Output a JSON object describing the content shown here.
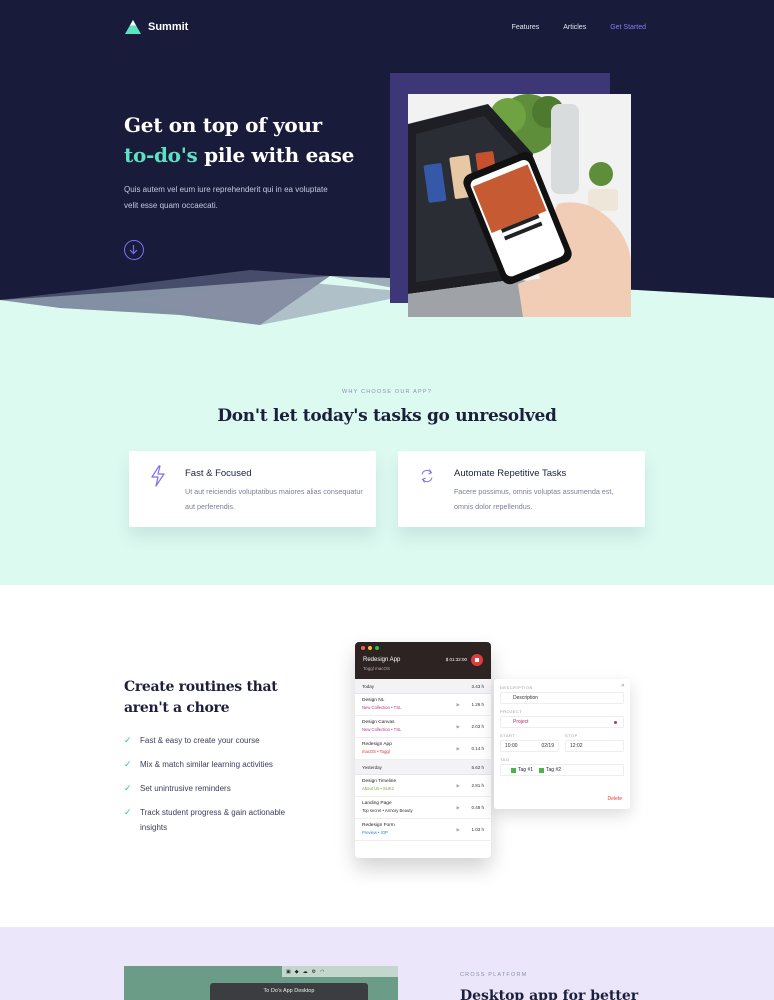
{
  "nav": {
    "brand": "Summit",
    "links": [
      "Features",
      "Articles"
    ],
    "cta": "Get Started"
  },
  "hero": {
    "title_line1": "Get on top of your",
    "title_accent": "to-do's",
    "title_rest": " pile with ease",
    "text": "Quis autem vel eum iure reprehenderit qui in ea voluptate velit esse quam occaecati."
  },
  "features": {
    "eyebrow": "WHY CHOOSE OUR APP?",
    "title": "Don't let today's tasks go unresolved",
    "cards": [
      {
        "title": "Fast & Focused",
        "desc": "Ut aut reiciendis voluptatibus maiores alias consequatur aut perferendis.",
        "icon": "lightning-icon"
      },
      {
        "title": "Automate Repetitive Tasks",
        "desc": "Facere possimus, omnis voluptas assumenda est, omnis dolor repellendus.",
        "icon": "sync-icon"
      }
    ]
  },
  "routines": {
    "title": "Create routines that aren't a chore",
    "items": [
      "Fast & easy to create your course",
      "Mix & match similar learning activities",
      "Set unintrusive reminders",
      "Track student progress & gain actionable insights"
    ]
  },
  "app": {
    "project": "Redesign App",
    "subtitle": "Toggl macOS",
    "timer": "$ 01:32:00",
    "groups": [
      {
        "label": "Today",
        "total": "3.43 h",
        "rows": [
          {
            "name": "Design NL",
            "client": "New Collection • TSL",
            "color": "#b03a8e",
            "dur": "1.26 h"
          },
          {
            "name": "Design Canvas",
            "client": "New Collection • TSL",
            "color": "#b03a8e",
            "dur": "2.03 h"
          },
          {
            "name": "Redesign App",
            "client": "macOS • Toggl",
            "color": "#d8303a",
            "dur": "0.14 h"
          }
        ]
      },
      {
        "label": "Yesterday",
        "total": "5.62 h",
        "rows": [
          {
            "name": "Design Timeline",
            "client": "About Us • SUK2",
            "color": "#6aa83a",
            "dur": "2.81 h"
          },
          {
            "name": "Landing Page",
            "client": "Top secret • Armory Beauty",
            "color": "#333333",
            "dur": "0.48 h"
          },
          {
            "name": "Redesign Form",
            "client": "Preview • IOP",
            "color": "#2e7dd6",
            "dur": "1.03 h"
          }
        ]
      }
    ]
  },
  "detail": {
    "desc_label": "DESCRIPTION",
    "desc_value": "Description",
    "project_label": "PROJECT",
    "project_value": "Project",
    "start_label": "START",
    "start_time": "10:00",
    "start_date": "02/19",
    "stop_label": "STOP",
    "stop_time": "12:02",
    "tag_label": "TAG",
    "tags": [
      "Tag #1",
      "Tag #2"
    ],
    "delete": "Delete"
  },
  "cross": {
    "eyebrow": "CROSS PLATFORM",
    "title": "Desktop app for better",
    "tooltip": "To Do's App Desktop"
  }
}
